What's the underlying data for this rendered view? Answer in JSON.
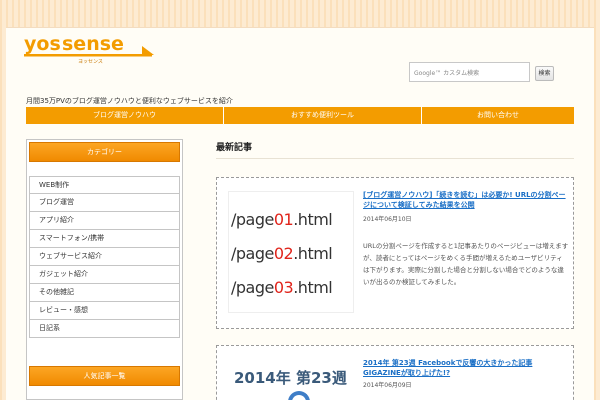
{
  "header": {
    "logo_text": "yossense",
    "logo_sub": "ヨッセンス",
    "tagline": "月間35万PVのブログ運営ノウハウと便利なウェブサービスを紹介",
    "search_brand": "Google™",
    "search_placeholder": "カスタム検索",
    "search_button": "検索"
  },
  "nav": {
    "items": [
      "ブログ運営ノウハウ",
      "おすすめ便利ツール",
      "お問い合わせ"
    ]
  },
  "sidebar": {
    "heading": "カテゴリー",
    "categories": [
      "WEB制作",
      "ブログ運営",
      "アプリ紹介",
      "スマートフォン/携帯",
      "ウェブサービス紹介",
      "ガジェット紹介",
      "その他雑記",
      "レビュー・感想",
      "日記系"
    ],
    "heading2": "人気記事一覧"
  },
  "main": {
    "section_title": "最新記事",
    "posts": [
      {
        "title": "[ブログ運営ノウハウ]「続きを読む」は必要か! URLの分割ページについて検証してみた結果を公開",
        "date": "2014年06月10日",
        "excerpt": "URLの分割ページを作成すると1記事あたりのページビューは増えますが、読者にとってはページをめくる手間が増えるためユーザビリティは下がります。実際に分割した場合と分割しない場合でどのような違いが出るのか検証してみました。",
        "thumb_lines": [
          "/page",
          "01",
          ".html",
          "/page",
          "02",
          ".html",
          "/page",
          "03",
          ".html"
        ]
      },
      {
        "title": "2014年 第23週 Facebookで反響の大きかった記事GIGAZINEが取り上げた!?",
        "date": "2014年06月09日",
        "thumb_text": "2014年 第23週"
      }
    ]
  },
  "colors": {
    "accent": "#f39c00",
    "link": "#1a6fc6",
    "thumb_highlight": "#e0241b"
  }
}
